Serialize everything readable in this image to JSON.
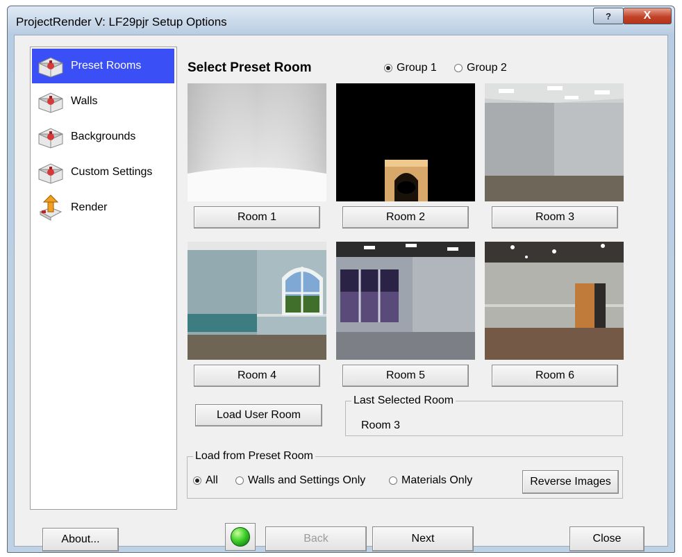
{
  "window": {
    "title": "ProjectRender V:  LF29pjr Setup Options",
    "help_glyph": "?",
    "close_glyph": "X"
  },
  "sidebar": {
    "items": [
      {
        "label": "Preset Rooms",
        "icon": "room-icon",
        "selected": true
      },
      {
        "label": "Walls",
        "icon": "room-icon",
        "selected": false
      },
      {
        "label": "Backgrounds",
        "icon": "room-icon",
        "selected": false
      },
      {
        "label": "Custom Settings",
        "icon": "room-icon",
        "selected": false
      },
      {
        "label": "Render",
        "icon": "render-icon",
        "selected": false
      }
    ]
  },
  "main": {
    "title": "Select Preset Room",
    "group_options": [
      {
        "label": "Group 1",
        "checked": true
      },
      {
        "label": "Group 2",
        "checked": false
      }
    ],
    "rooms": [
      {
        "label": "Room 1",
        "image": "white-cyclorama-room"
      },
      {
        "label": "Room 2",
        "image": "black-room-with-fireplace"
      },
      {
        "label": "Room 3",
        "image": "gray-room-ceiling-lights"
      },
      {
        "label": "Room 4",
        "image": "teal-room-arched-window"
      },
      {
        "label": "Room 5",
        "image": "room-with-night-windows"
      },
      {
        "label": "Room 6",
        "image": "room-with-wood-door"
      }
    ],
    "load_user_room": "Load User Room",
    "last_selected": {
      "legend": "Last Selected Room",
      "value": "Room 3"
    },
    "load_from": {
      "legend": "Load from Preset Room",
      "options": [
        {
          "label": "All",
          "checked": true
        },
        {
          "label": "Walls and Settings Only",
          "checked": false
        },
        {
          "label": "Materials Only",
          "checked": false
        }
      ],
      "reverse_images": "Reverse Images"
    }
  },
  "footer": {
    "about": "About...",
    "back": "Back",
    "next": "Next",
    "close": "Close",
    "status_color": "#3fcf2a"
  }
}
